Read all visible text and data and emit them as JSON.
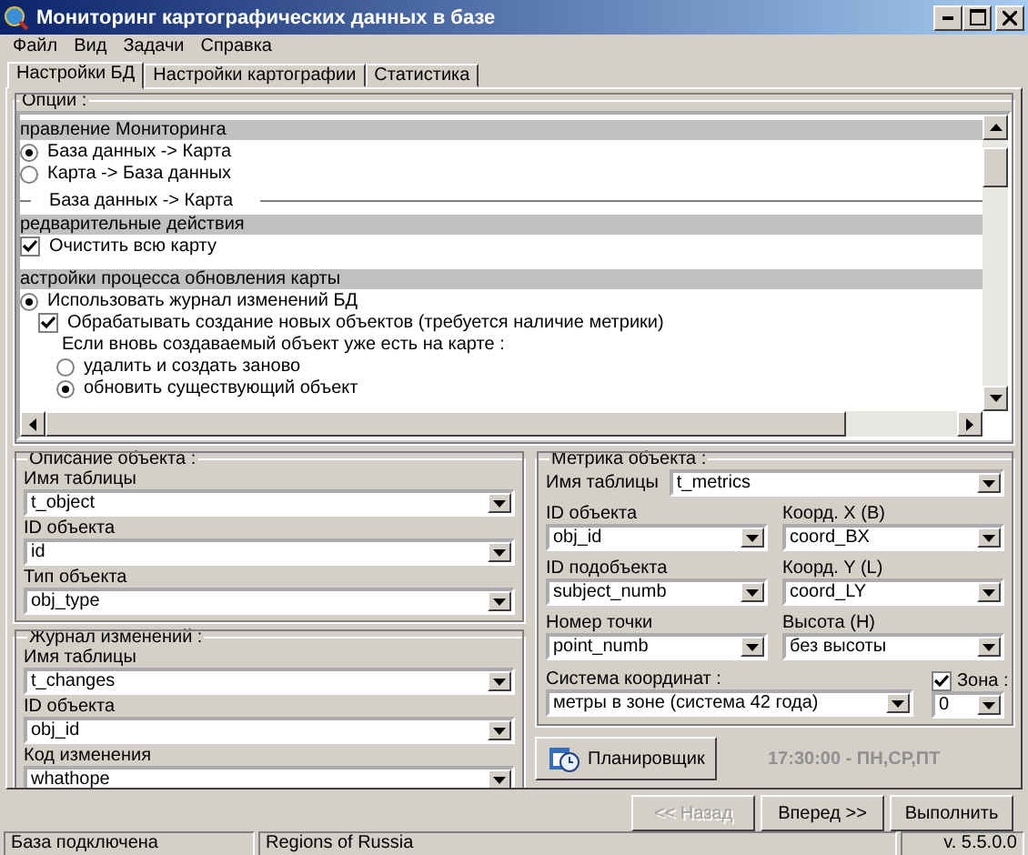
{
  "window": {
    "title": "Мониторинг картографических данных в базе"
  },
  "menu": [
    "Файл",
    "Вид",
    "Задачи",
    "Справка"
  ],
  "tabs": [
    {
      "label": "Настройки БД",
      "selected": true
    },
    {
      "label": "Настройки картографии",
      "selected": false
    },
    {
      "label": "Статистика",
      "selected": false
    }
  ],
  "options": {
    "title": "Опции :",
    "items": [
      {
        "kind": "header",
        "text": "правление Мониторинга"
      },
      {
        "kind": "radio",
        "label": "База данных -> Карта",
        "selected": true
      },
      {
        "kind": "radio",
        "label": "Карта -> База данных",
        "selected": false
      },
      {
        "kind": "separator",
        "label": "База данных -> Карта"
      },
      {
        "kind": "header",
        "text": "редварительные действия"
      },
      {
        "kind": "checkbox",
        "label": "Очистить всю карту",
        "checked": true
      },
      {
        "kind": "gap"
      },
      {
        "kind": "header",
        "text": "астройки процесса обновления карты"
      },
      {
        "kind": "radio",
        "label": "Использовать журнал изменений БД",
        "selected": true,
        "children": [
          {
            "kind": "checkbox",
            "label": "Обрабатывать создание новых объектов (требуется наличие метрики)",
            "checked": true,
            "children": [
              {
                "kind": "label",
                "text": "Если вновь создаваемый объект уже есть на карте :"
              },
              {
                "kind": "radio",
                "label": "удалить и создать заново",
                "selected": false
              },
              {
                "kind": "radio",
                "label": "обновить существующий объект",
                "selected": true
              }
            ]
          }
        ]
      }
    ]
  },
  "object_description": {
    "title": "Описание объекта :",
    "fields": [
      {
        "label": "Имя таблицы",
        "value": "t_object"
      },
      {
        "label": "ID объекта",
        "value": "id"
      },
      {
        "label": "Тип объекта",
        "value": "obj_type"
      }
    ]
  },
  "change_log": {
    "title": "Журнал изменений :",
    "fields": [
      {
        "label": "Имя таблицы",
        "value": "t_changes"
      },
      {
        "label": "ID объекта",
        "value": "obj_id"
      },
      {
        "label": "Код изменения",
        "value": "whathope"
      }
    ]
  },
  "metrics": {
    "title": "Метрика объекта :",
    "table": {
      "label": "Имя таблицы",
      "value": "t_metrics"
    },
    "fields": [
      {
        "label": "ID объекта",
        "value": "obj_id"
      },
      {
        "label": "Коорд. X (B)",
        "value": "coord_BX"
      },
      {
        "label": "ID подобъекта",
        "value": "subject_numb"
      },
      {
        "label": "Коорд. Y (L)",
        "value": "coord_LY"
      },
      {
        "label": "Номер точки",
        "value": "point_numb"
      },
      {
        "label": "Высота (H)",
        "value": "без высоты"
      }
    ],
    "coord_system": {
      "label": "Система координат :",
      "value": "метры в зоне (система 42 года)"
    },
    "zone": {
      "label": "Зона :",
      "checked": true,
      "value": "0"
    }
  },
  "scheduler": {
    "button": "Планировщик",
    "schedule": "17:30:00 - ПН,СР,ПТ"
  },
  "buttons": [
    {
      "label": "<< Назад",
      "disabled": true
    },
    {
      "label": "Вперед >>",
      "disabled": false
    },
    {
      "label": "Выполнить",
      "disabled": false
    }
  ],
  "status_bar": [
    "База подключена",
    "Regions of Russia",
    "v. 5.5.0.0"
  ]
}
